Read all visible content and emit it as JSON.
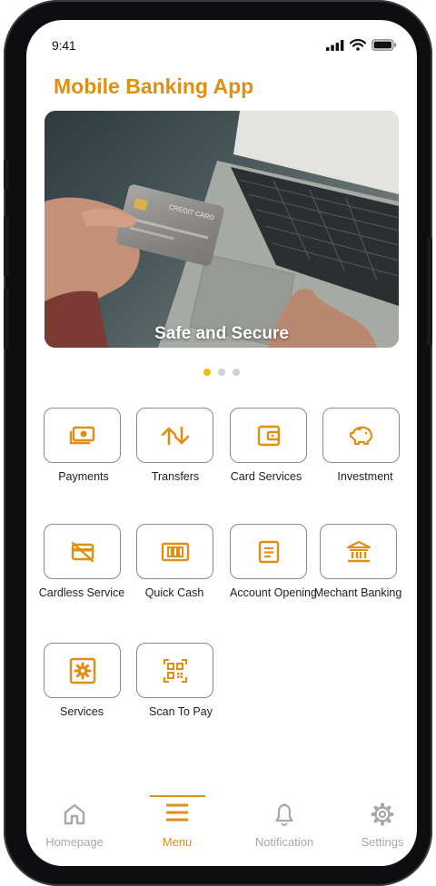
{
  "status": {
    "time": "9:41"
  },
  "app": {
    "title": "Mobile Banking App"
  },
  "banner": {
    "caption": "Safe and Secure",
    "card_text": "CREDIT CARD"
  },
  "carousel": {
    "count": 3,
    "active_index": 0
  },
  "colors": {
    "accent": "#e08e14",
    "dot_active": "#f5b90d",
    "inactive": "#a8a8a8"
  },
  "menu": {
    "items": [
      {
        "label": "Payments",
        "icon": "payments-icon"
      },
      {
        "label": "Transfers",
        "icon": "transfers-icon"
      },
      {
        "label": "Card Services",
        "icon": "card-services-icon"
      },
      {
        "label": "Investment",
        "icon": "investment-icon"
      },
      {
        "label": "Cardless Service",
        "icon": "cardless-icon"
      },
      {
        "label": "Quick Cash",
        "icon": "quick-cash-icon"
      },
      {
        "label": "Account Opening",
        "icon": "account-opening-icon"
      },
      {
        "label": "Mechant Banking",
        "icon": "merchant-banking-icon"
      },
      {
        "label": "Services",
        "icon": "services-icon"
      },
      {
        "label": "Scan To Pay",
        "icon": "qr-scan-icon"
      }
    ]
  },
  "nav": {
    "items": [
      {
        "label": "Homepage",
        "icon": "home-icon",
        "active": false
      },
      {
        "label": "Menu",
        "icon": "menu-icon",
        "active": true
      },
      {
        "label": "Notification",
        "icon": "bell-icon",
        "active": false
      },
      {
        "label": "Settings",
        "icon": "gear-icon",
        "active": false
      }
    ]
  }
}
